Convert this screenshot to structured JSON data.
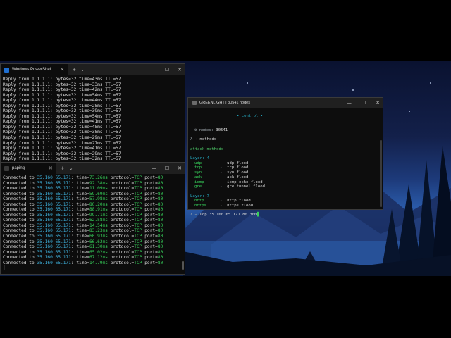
{
  "desktop": {
    "theme": "night-mountain-lake"
  },
  "powershell": {
    "tab_title": "Windows PowerShell",
    "new_tab": "+",
    "dropdown": "⌄",
    "controls": {
      "minimize": "—",
      "maximize": "☐",
      "close": "✕"
    },
    "ping_lines": [
      "Reply from 1.1.1.1: bytes=32 time=43ms TTL=57",
      "Reply from 1.1.1.1: bytes=32 time=33ms TTL=57",
      "Reply from 1.1.1.1: bytes=32 time=42ms TTL=57",
      "Reply from 1.1.1.1: bytes=32 time=54ms TTL=57",
      "Reply from 1.1.1.1: bytes=32 time=44ms TTL=57",
      "Reply from 1.1.1.1: bytes=32 time=28ms TTL=57",
      "Reply from 1.1.1.1: bytes=32 time=39ms TTL=57",
      "Reply from 1.1.1.1: bytes=32 time=54ms TTL=57",
      "Reply from 1.1.1.1: bytes=32 time=41ms TTL=57",
      "Reply from 1.1.1.1: bytes=32 time=48ms TTL=57",
      "Reply from 1.1.1.1: bytes=32 time=38ms TTL=57",
      "Reply from 1.1.1.1: bytes=32 time=29ms TTL=57",
      "Reply from 1.1.1.1: bytes=32 time=27ms TTL=57",
      "Reply from 1.1.1.1: bytes=32 time=41ms TTL=57",
      "Reply from 1.1.1.1: bytes=32 time=29ms TTL=57",
      "Reply from 1.1.1.1: bytes=32 time=32ms TTL=57"
    ]
  },
  "paping": {
    "tab_title": "paping",
    "new_tab": "+",
    "dropdown": "⌄",
    "controls": {
      "minimize": "—",
      "maximize": "☐",
      "close": "✕"
    },
    "ip": "35.160.65.171",
    "lines": [
      {
        "prefix": "Connected to ",
        "time": "73.26ms"
      },
      {
        "prefix": "Connected to ",
        "time": "92.38ms"
      },
      {
        "prefix": "Connected to ",
        "time": "11.09ms"
      },
      {
        "prefix": "Connected to ",
        "time": "59.69ms"
      },
      {
        "prefix": "Connected to ",
        "time": "57.98ms"
      },
      {
        "prefix": "Connected to ",
        "time": "80.20ms"
      },
      {
        "prefix": "Connected to ",
        "time": "88.91ms"
      },
      {
        "prefix": "Connected to ",
        "time": "99.71ms"
      },
      {
        "prefix": "Connected to ",
        "time": "62.58ms"
      },
      {
        "prefix": "Connected to ",
        "time": "14.54ms"
      },
      {
        "prefix": "Connected to ",
        "time": "83.23ms"
      },
      {
        "prefix": "Connected to ",
        "time": "60.93ms"
      },
      {
        "prefix": "Connected to ",
        "time": "66.62ms"
      },
      {
        "prefix": "Connected to ",
        "time": "61.30ms"
      },
      {
        "prefix": "Connected to ",
        "time": "65.02ms"
      },
      {
        "prefix": "Connected to ",
        "time": "67.12ms"
      },
      {
        "prefix": "Connected to ",
        "time": "14.79ms"
      }
    ],
    "protocol": "TCP",
    "port": "80"
  },
  "greenlight": {
    "title": "GREENLIGHT | 30541 nodes",
    "controls": {
      "minimize": "—",
      "maximize": "☐",
      "close": "✕"
    },
    "control_header": "• control •",
    "nodes_label": "⚙ nodes:",
    "nodes_value": "30541",
    "prompt": "λ →",
    "cmd_methods": "methods",
    "attack_methods": "attack methods",
    "layer4_label": "Layer: 4",
    "layer4": [
      {
        "name": "udp",
        "desc": "udp flood"
      },
      {
        "name": "tcp",
        "desc": "tcp flood"
      },
      {
        "name": "syn",
        "desc": "syn flood"
      },
      {
        "name": "ack",
        "desc": "ack flood"
      },
      {
        "name": "icmp",
        "desc": "icmp echo flood"
      },
      {
        "name": "gre",
        "desc": "gre tunnel flood"
      }
    ],
    "layer7_label": "Layer: 7",
    "layer7": [
      {
        "name": "http",
        "desc": "http flood"
      },
      {
        "name": "https",
        "desc": "https flood"
      }
    ],
    "current_cmd": "udp 35.160.65.171 80 300"
  }
}
